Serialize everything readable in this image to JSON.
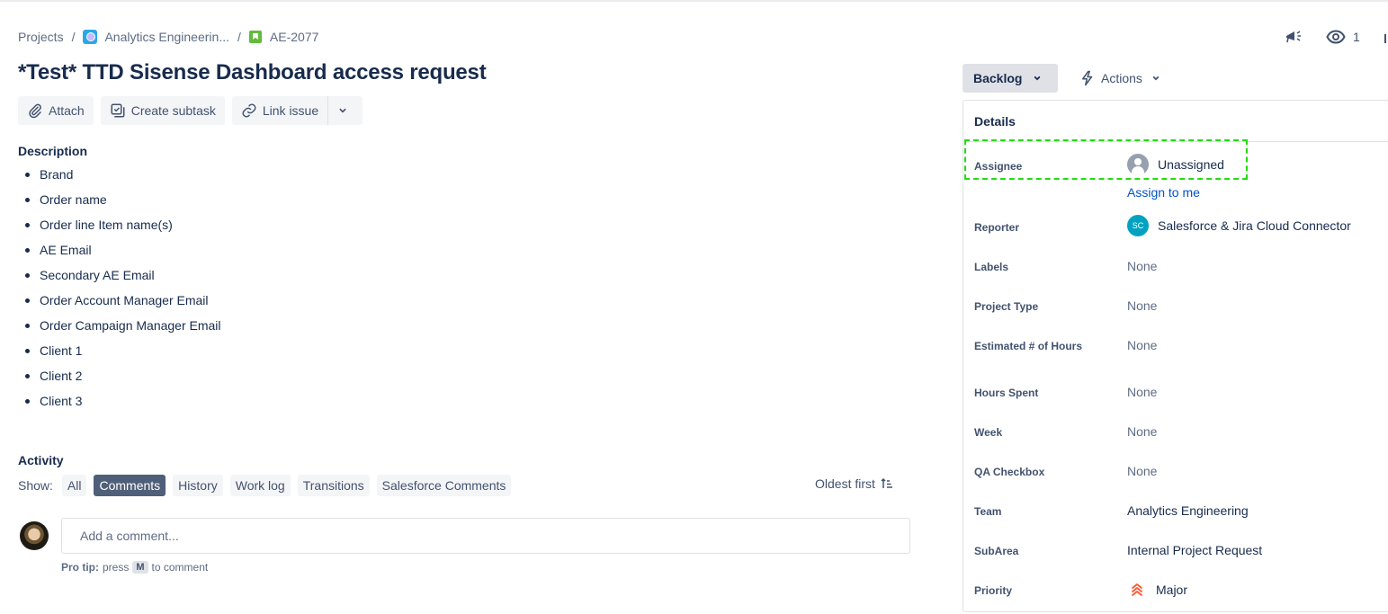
{
  "breadcrumb": {
    "projects": "Projects",
    "project": "Analytics Engineerin...",
    "issue_key": "AE-2077"
  },
  "issue": {
    "title": "*Test* TTD Sisense Dashboard access request"
  },
  "toolbar": {
    "attach": "Attach",
    "create_subtask": "Create subtask",
    "link_issue": "Link issue"
  },
  "description": {
    "heading": "Description",
    "items": [
      "Brand",
      "Order name",
      "Order line Item name(s)",
      "AE Email",
      "Secondary AE Email",
      "Order Account Manager Email",
      "Order Campaign Manager Email",
      "Client 1",
      "Client 2",
      "Client 3"
    ]
  },
  "activity": {
    "heading": "Activity",
    "show_label": "Show:",
    "filters": [
      "All",
      "Comments",
      "History",
      "Work log",
      "Transitions",
      "Salesforce Comments"
    ],
    "active_filter": "Comments",
    "sort": "Oldest first",
    "comment_placeholder": "Add a comment...",
    "pro_tip_bold": "Pro tip:",
    "pro_tip_press": "press",
    "pro_tip_key": "M",
    "pro_tip_rest": "to comment"
  },
  "header_actions": {
    "watch_count": "1",
    "status": "Backlog",
    "actions": "Actions"
  },
  "details": {
    "heading": "Details",
    "assign_to_me": "Assign to me",
    "fields": [
      {
        "label": "Assignee",
        "value": "Unassigned"
      },
      {
        "label": "Reporter",
        "value": "Salesforce & Jira Cloud Connector",
        "initials": "SC"
      },
      {
        "label": "Labels",
        "value": "None"
      },
      {
        "label": "Project Type",
        "value": "None"
      },
      {
        "label": "Estimated # of Hours",
        "value": "None"
      },
      {
        "label": "Hours Spent",
        "value": "None"
      },
      {
        "label": "Week",
        "value": "None"
      },
      {
        "label": "QA Checkbox",
        "value": "None"
      },
      {
        "label": "Team",
        "value": "Analytics Engineering"
      },
      {
        "label": "SubArea",
        "value": "Internal Project Request"
      },
      {
        "label": "Priority",
        "value": "Major"
      }
    ]
  },
  "colors": {
    "priority_major": "#ff5630",
    "link": "#0052cc",
    "highlight": "#22dd11",
    "active_filter_bg": "#505f79"
  }
}
